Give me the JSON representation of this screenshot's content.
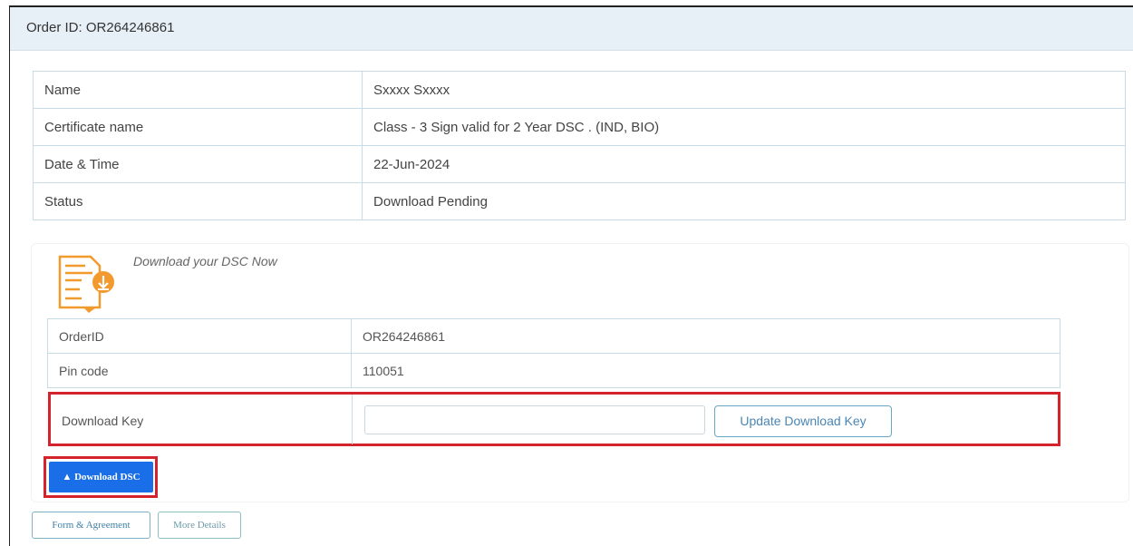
{
  "order": {
    "header": "Order ID: OR264246861"
  },
  "info_table": {
    "rows": [
      {
        "label": "Name",
        "value": "Sxxxx Sxxxx"
      },
      {
        "label": "Certificate name",
        "value": "Class - 3 Sign valid for 2 Year DSC . (IND, BIO)"
      },
      {
        "label": "Date & Time",
        "value": "22-Jun-2024"
      },
      {
        "label": "Status",
        "value": "Download Pending"
      }
    ]
  },
  "download_section": {
    "title": "Download your DSC Now",
    "icon": "certificate-download-icon",
    "rows": [
      {
        "label": "OrderID",
        "value": "OR264246861"
      },
      {
        "label": "Pin code",
        "value": "110051"
      }
    ],
    "key_label": "Download Key",
    "key_value": "",
    "key_placeholder": "",
    "update_button": "Update Download Key",
    "download_button": "Download DSC",
    "download_icon": "upload-triangle-icon"
  },
  "footer_buttons": {
    "form_agreement": "Form & Agreement",
    "more_details": "More Details"
  },
  "colors": {
    "status_pending": "#e0505b",
    "primary_button": "#1a6fe8",
    "highlight_border": "#d4232d",
    "icon_orange": "#f29a2e"
  }
}
